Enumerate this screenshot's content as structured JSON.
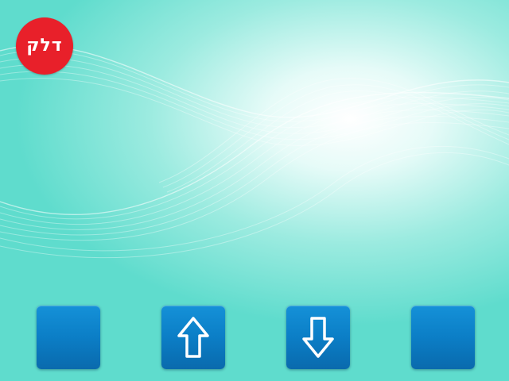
{
  "logo": {
    "text": "דלק",
    "color": "#e8202a"
  },
  "buttons": [
    {
      "name": "blank-button-left",
      "icon": null
    },
    {
      "name": "scroll-up-button",
      "icon": "arrow-up-icon"
    },
    {
      "name": "scroll-down-button",
      "icon": "arrow-down-icon"
    },
    {
      "name": "blank-button-right",
      "icon": null
    }
  ],
  "colors": {
    "background": "#5fdccd",
    "button": "#0b7ec6",
    "icon_stroke": "#ffffff"
  }
}
